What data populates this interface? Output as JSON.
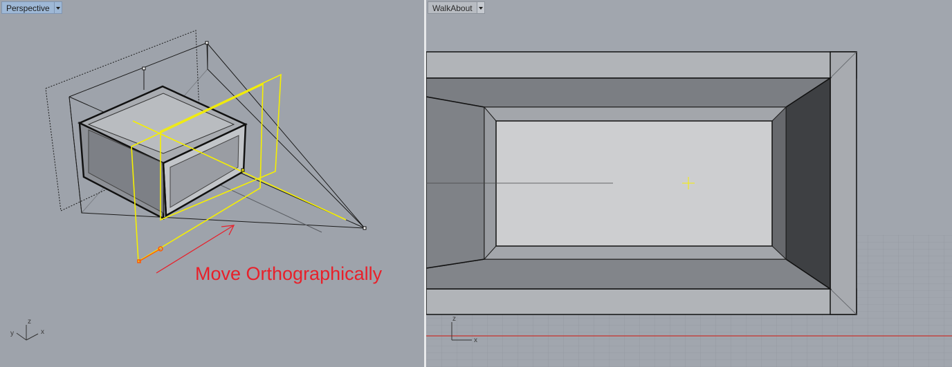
{
  "viewports": {
    "left": {
      "name": "Perspective",
      "active": true
    },
    "right": {
      "name": "WalkAbout",
      "active": false
    }
  },
  "annotation": {
    "text": "Move Orthographically",
    "color": "#e8202a"
  },
  "axis_widget": {
    "x": "x",
    "y": "y",
    "z": "z"
  },
  "colors": {
    "viewport_bg": "#9ea3ab",
    "active_tab": "#9eb8d6",
    "selection_yellow": "#ffff00",
    "ground_red_axis": "#c8322c"
  }
}
